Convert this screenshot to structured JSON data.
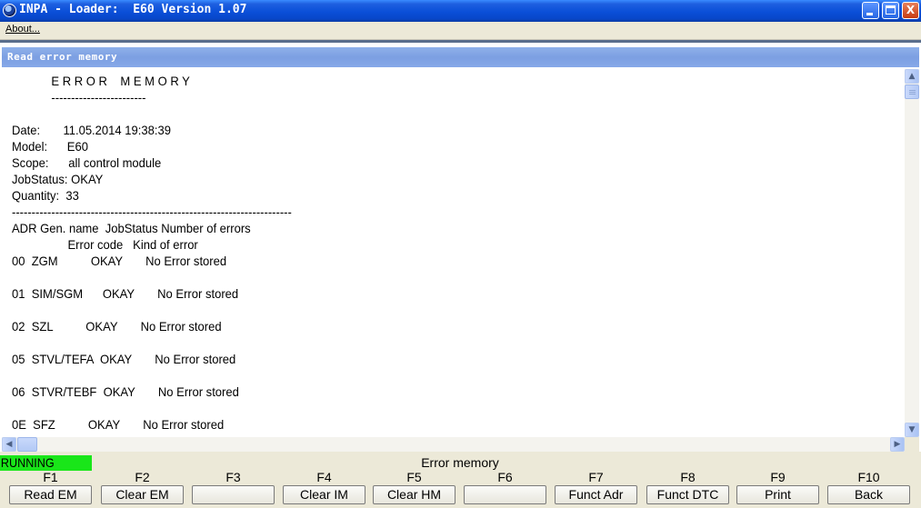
{
  "window": {
    "title": "INPA - Loader:  E60 Version 1.07",
    "minimize_glyph": "",
    "maximize_glyph": "",
    "close_glyph": "X"
  },
  "menu": {
    "about": "About..."
  },
  "panel": {
    "title": "Read error memory"
  },
  "report": {
    "lines": [
      "            E R R O R    M E M O R Y",
      "            ------------------------",
      "",
      "Date:       11.05.2014 19:38:39",
      "Model:      E60",
      "Scope:      all control module",
      "JobStatus: OKAY",
      "Quantity:  33",
      "-----------------------------------------------------------------------",
      "ADR Gen. name  JobStatus Number of errors",
      "                 Error code   Kind of error",
      "00  ZGM          OKAY       No Error stored",
      "",
      "01  SIM/SGM      OKAY       No Error stored",
      "",
      "02  SZL          OKAY       No Error stored",
      "",
      "05  STVL/TEFA  OKAY       No Error stored",
      "",
      "06  STVR/TEBF  OKAY       No Error stored",
      "",
      "0E  SFZ          OKAY       No Error stored"
    ]
  },
  "status": {
    "state": "RUNNING",
    "mode": "Error memory",
    "state_color": "#19e619"
  },
  "function_keys": [
    {
      "key": "F1",
      "label": "Read EM"
    },
    {
      "key": "F2",
      "label": "Clear EM"
    },
    {
      "key": "F3",
      "label": ""
    },
    {
      "key": "F4",
      "label": "Clear IM"
    },
    {
      "key": "F5",
      "label": "Clear HM"
    },
    {
      "key": "F6",
      "label": ""
    },
    {
      "key": "F7",
      "label": "Funct Adr"
    },
    {
      "key": "F8",
      "label": "Funct DTC"
    },
    {
      "key": "F9",
      "label": "Print"
    },
    {
      "key": "F10",
      "label": "Back"
    }
  ]
}
